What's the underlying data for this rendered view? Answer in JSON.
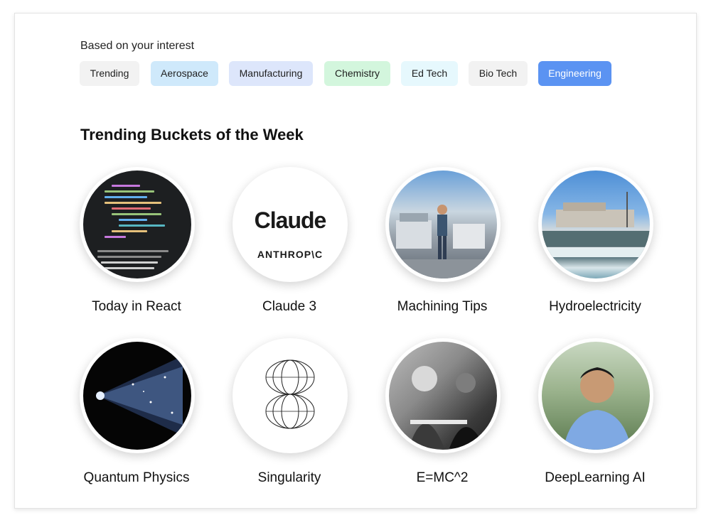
{
  "interest": {
    "label": "Based on your interest",
    "chips": [
      {
        "label": "Trending",
        "bg": "#f2f2f2"
      },
      {
        "label": "Aerospace",
        "bg": "#cfe9fb"
      },
      {
        "label": "Manufacturing",
        "bg": "#dde6fb"
      },
      {
        "label": "Chemistry",
        "bg": "#d3f6dd"
      },
      {
        "label": "Ed Tech",
        "bg": "#e6f8fd"
      },
      {
        "label": "Bio Tech",
        "bg": "#f2f2f2"
      },
      {
        "label": "Engineering",
        "bg": "#5b93f2",
        "active": true
      }
    ]
  },
  "section": {
    "title": "Trending Buckets of the Week"
  },
  "buckets": [
    {
      "label": "Today in React"
    },
    {
      "label": "Claude 3",
      "logo_text": "Claude",
      "sub_text": "ANTHROP\\C"
    },
    {
      "label": "Machining Tips"
    },
    {
      "label": "Hydroelectricity"
    },
    {
      "label": "Quantum Physics"
    },
    {
      "label": "Singularity"
    },
    {
      "label": "E=MC^2"
    },
    {
      "label": "DeepLearning AI"
    }
  ]
}
